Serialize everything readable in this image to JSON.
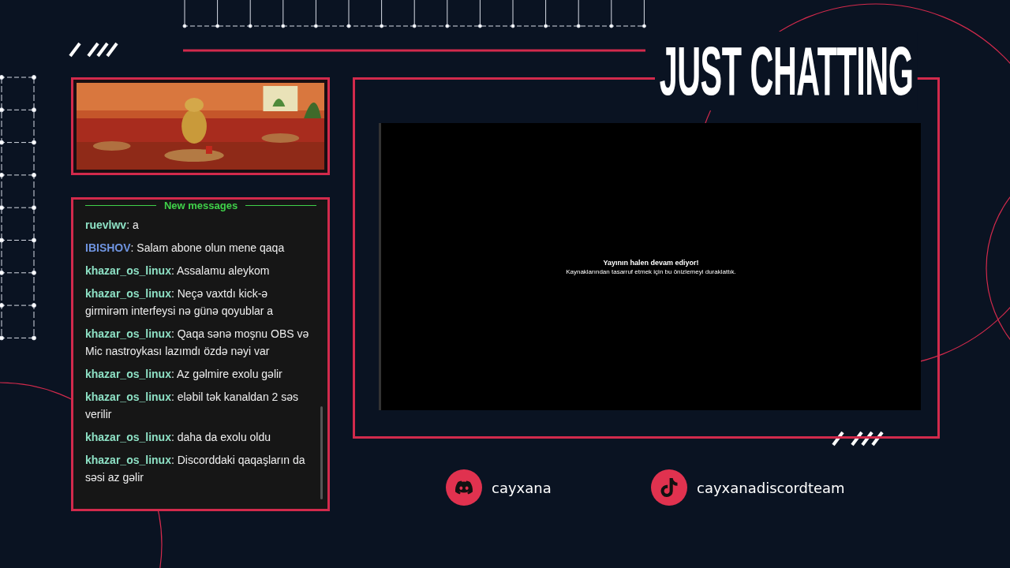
{
  "title": "JUST CHATTING",
  "chat": {
    "divider": "New messages",
    "messages": [
      {
        "user": "ruevlwv",
        "color": "#8de0c4",
        "text": ": a"
      },
      {
        "user": "IBISHOV",
        "color": "#6f94e0",
        "text": ": Salam abone olun mene qaqa"
      },
      {
        "user": "khazar_os_linux",
        "color": "#8de0c4",
        "text": ": Assalamu aleykom"
      },
      {
        "user": "khazar_os_linux",
        "color": "#8de0c4",
        "text": ": Neçə vaxtdı kick-ə girmirəm interfeysi nə günə qoyublar a"
      },
      {
        "user": "khazar_os_linux",
        "color": "#8de0c4",
        "text": ": Qaqa sənə moşnu OBS və Mic nastroykası lazımdı özdə nəyi var"
      },
      {
        "user": "khazar_os_linux",
        "color": "#8de0c4",
        "text": ": Az gəlmire exolu gəlir"
      },
      {
        "user": "khazar_os_linux",
        "color": "#8de0c4",
        "text": ": eləbil tək kanaldan 2 səs verilir"
      },
      {
        "user": "khazar_os_linux",
        "color": "#8de0c4",
        "text": ": daha da exolu oldu"
      },
      {
        "user": "khazar_os_linux",
        "color": "#8de0c4",
        "text": ": Discorddaki qaqaşların da səsi az gəlir"
      }
    ]
  },
  "screen": {
    "heading": "Yayının halen devam ediyor!",
    "subtext": "Kaynaklarından tasarruf etmek için bu önizlemeyi duraklattık."
  },
  "socials": [
    {
      "kind": "discord",
      "handle": "cayxana"
    },
    {
      "kind": "tiktok",
      "handle": "cayxanadiscordteam"
    }
  ]
}
